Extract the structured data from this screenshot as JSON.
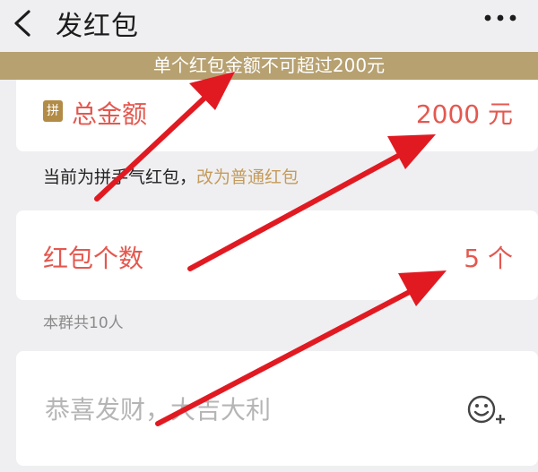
{
  "nav": {
    "title": "发红包",
    "back_icon": "chevron-left-icon",
    "more_icon": "more-dots-icon"
  },
  "warning": {
    "text": "单个红包金额不可超过200元"
  },
  "total": {
    "badge": "拼",
    "label": "总金额",
    "value": "2000 元"
  },
  "hint": {
    "text": "当前为拼手气红包，",
    "link": "改为普通红包"
  },
  "count": {
    "label": "红包个数",
    "value": "5 个"
  },
  "members": {
    "text": "本群共10人"
  },
  "greeting": {
    "placeholder": "恭喜发财，大吉大利",
    "emoji_icon": "emoji-add-icon"
  },
  "colors": {
    "accent_red": "#e4584f",
    "banner_gold": "#b7a171",
    "link_gold": "#c59b5b",
    "arrow_red": "#e11a22"
  }
}
